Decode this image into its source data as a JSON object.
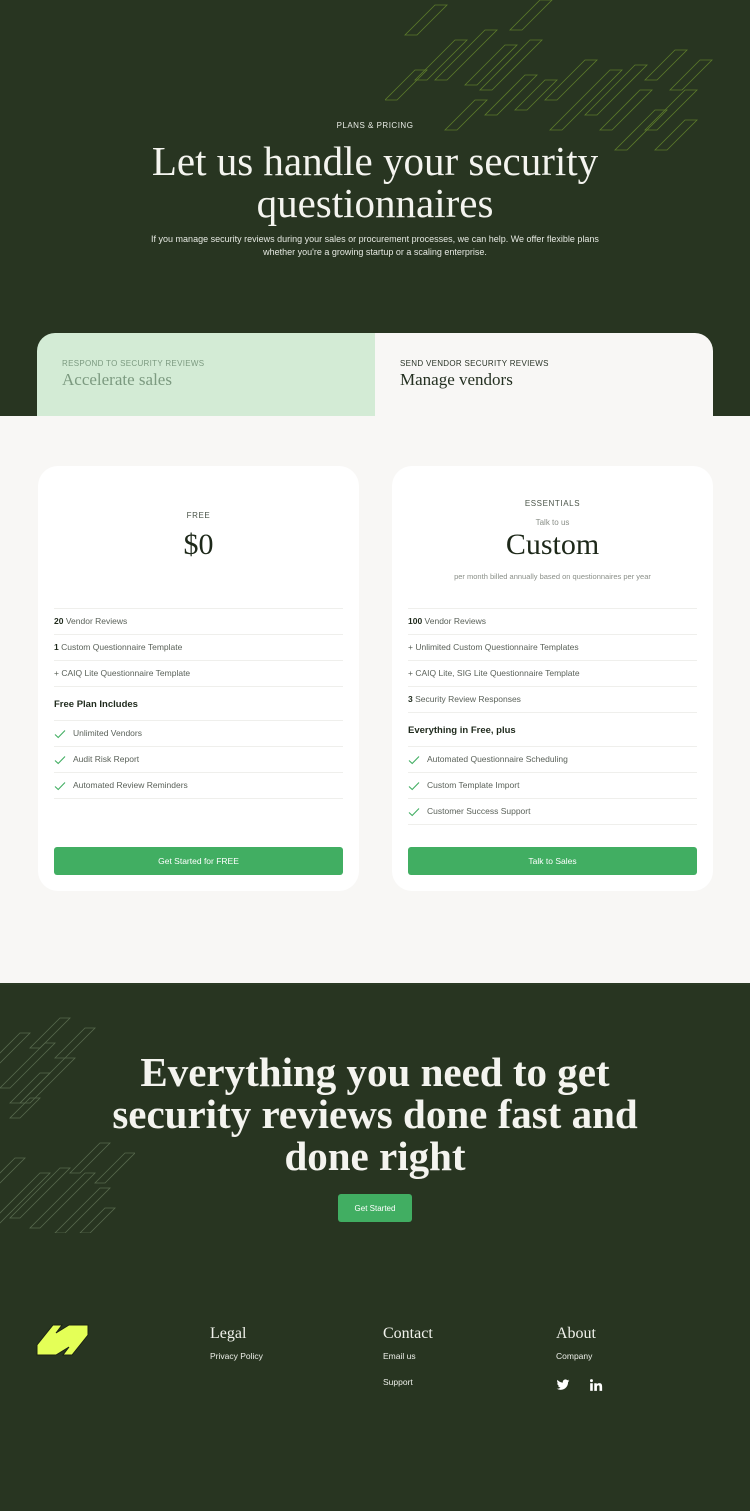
{
  "hero": {
    "eyebrow": "PLANS & PRICING",
    "title_line1": "Let us handle your security",
    "title_line2": "questionnaires",
    "subtitle_line1": "If you manage security reviews during your sales or procurement processes, we can help. We offer flexible plans",
    "subtitle_line2": "whether you're a growing startup or a scaling enterprise."
  },
  "tabs": [
    {
      "eyebrow": "RESPOND TO SECURITY REVIEWS",
      "title": "Accelerate sales",
      "active": false
    },
    {
      "eyebrow": "SEND VENDOR SECURITY REVIEWS",
      "title": "Manage vendors",
      "active": true
    }
  ],
  "plans": {
    "free": {
      "name": "FREE",
      "price": "$0",
      "features": [
        {
          "bold": "20",
          "text": " Vendor Reviews"
        },
        {
          "bold": "1",
          "text": " Custom Questionnaire Template"
        },
        {
          "bold": "",
          "text": "+ CAIQ Lite Questionnaire Template"
        }
      ],
      "includes_heading": "Free Plan Includes",
      "includes": [
        "Unlimited Vendors",
        "Audit Risk Report",
        "Automated Review Reminders"
      ],
      "cta": "Get Started for FREE"
    },
    "essentials": {
      "name": "ESSENTIALS",
      "note": "Talk to us",
      "price": "Custom",
      "billing": "per month billed annually based on questionnaires per year",
      "features": [
        {
          "bold": "100",
          "text": " Vendor Reviews"
        },
        {
          "bold": "",
          "text": "+ Unlimited Custom Questionnaire Templates"
        },
        {
          "bold": "",
          "text": "+ CAIQ Lite, SIG Lite Questionnaire Template"
        },
        {
          "bold": "3",
          "text": " Security Review Responses"
        }
      ],
      "includes_heading": "Everything in Free, plus",
      "includes": [
        "Automated Questionnaire Scheduling",
        "Custom Template Import",
        "Customer Success Support"
      ],
      "cta": "Talk to Sales"
    }
  },
  "bottom_cta": {
    "title_line1": "Everything you need to get",
    "title_line2": "security reviews done fast and",
    "title_line3": "done right",
    "button": "Get Started"
  },
  "footer": {
    "logo_icon": "brand-logo-icon",
    "columns": {
      "legal": {
        "title": "Legal",
        "links": [
          "Privacy Policy"
        ]
      },
      "contact": {
        "title": "Contact",
        "links": [
          "Email us",
          "Support"
        ]
      },
      "about": {
        "title": "About",
        "links": [
          "Company"
        ]
      }
    },
    "social": [
      "twitter-icon",
      "linkedin-icon"
    ]
  },
  "colors": {
    "dark_green": "#283521",
    "accent_green": "#41ae62",
    "tab_active_bg": "#d3ebd5",
    "logo_yellow": "#e4ff57",
    "light_bg": "#f8f7f5"
  }
}
